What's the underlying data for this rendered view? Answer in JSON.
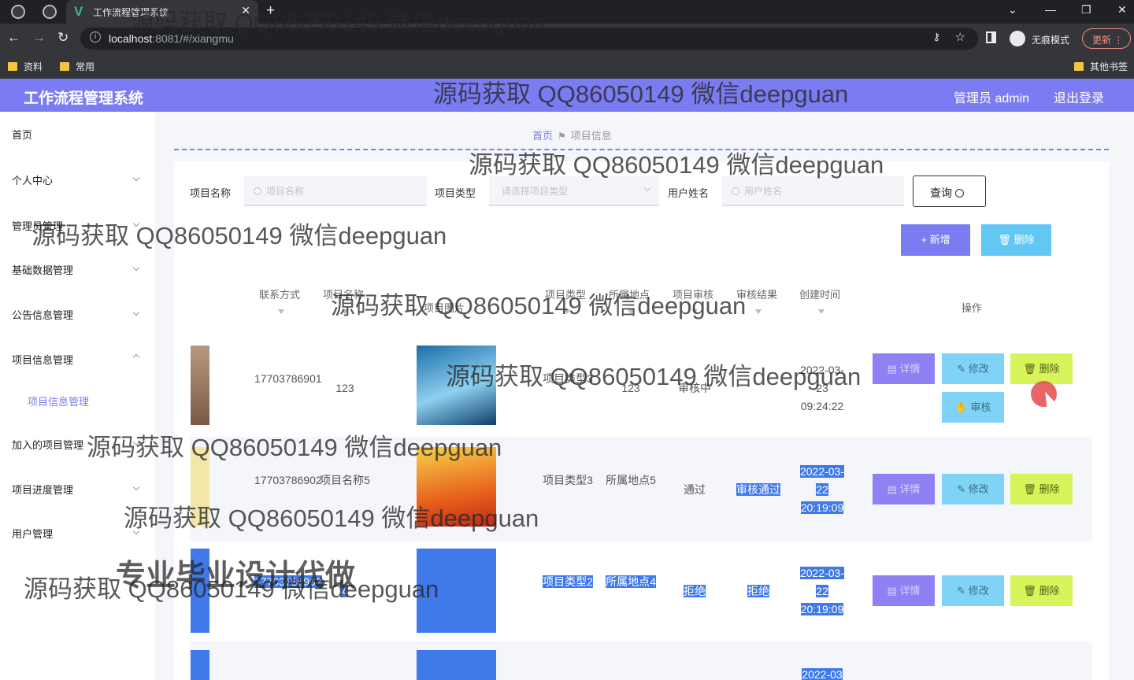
{
  "browser": {
    "tab_title": "工作流程管理系统",
    "url_host": "localhost",
    "url_path": ":8081/#/xiangmu",
    "incognito_label": "无痕模式",
    "update_label": "更新",
    "bookmarks": [
      "资料",
      "常用"
    ],
    "other_bookmarks": "其他书签"
  },
  "header": {
    "title": "工作流程管理系统",
    "admin": "管理员 admin",
    "logout": "退出登录"
  },
  "sidebar": {
    "items": [
      "首页",
      "个人中心",
      "管理员管理",
      "基础数据管理",
      "公告信息管理",
      "项目信息管理",
      "项目信息管理",
      "加入的项目管理",
      "项目进度管理",
      "用户管理"
    ]
  },
  "breadcrumb": {
    "home": "首页",
    "current": "项目信息"
  },
  "filters": {
    "name_label": "项目名称",
    "name_placeholder": "项目名称",
    "type_label": "项目类型",
    "type_placeholder": "请选择项目类型",
    "user_label": "用户姓名",
    "user_placeholder": "用户姓名",
    "query": "查询"
  },
  "toolbar": {
    "add": "+ 新增",
    "delete": "删除"
  },
  "table": {
    "headers": [
      "联系方式",
      "项目名称",
      "项目图片",
      "项目类型",
      "所属地点",
      "项目审核",
      "审核结果",
      "创建时间",
      "操作"
    ],
    "rows": [
      {
        "phone": "17703786901",
        "name": "123",
        "type": "项目类型3",
        "place": "123",
        "audit": "审核中",
        "result": "",
        "created": "2022-03-23 09:24:22"
      },
      {
        "phone": "17703786902",
        "name": "项目名称5",
        "type": "项目类型3",
        "place": "所属地点5",
        "audit": "通过",
        "result": "审核通过",
        "created": "2022-03-22 20:19:09"
      },
      {
        "phone": "17703786902",
        "name": "4",
        "type": "项目类型2",
        "place": "所属地点4",
        "audit": "拒绝",
        "result": "拒绝",
        "created": "2022-03-22 20:19:09"
      },
      {
        "created": "2022-03"
      }
    ],
    "actions": {
      "detail": "详情",
      "edit": "修改",
      "delete": "删除",
      "audit": "审核"
    }
  },
  "overlay": {
    "watermark": "源码获取 QQ86050149 微信deepguan",
    "stamp": "专业毕业设计代做"
  }
}
